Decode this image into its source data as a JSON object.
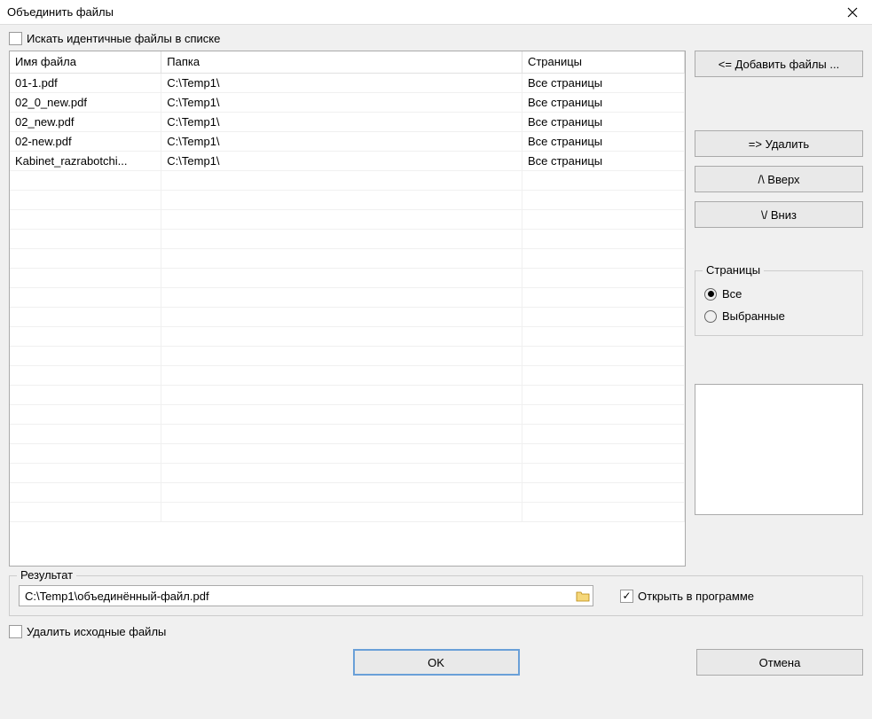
{
  "window": {
    "title": "Объединить файлы"
  },
  "search_checkbox": {
    "checked": false,
    "label": "Искать идентичные файлы в списке"
  },
  "table": {
    "headers": {
      "name": "Имя файла",
      "folder": "Папка",
      "pages": "Страницы"
    },
    "rows": [
      {
        "name": "01-1.pdf",
        "folder": "C:\\Temp1\\",
        "pages": "Все страницы"
      },
      {
        "name": "02_0_new.pdf",
        "folder": "C:\\Temp1\\",
        "pages": "Все страницы"
      },
      {
        "name": "02_new.pdf",
        "folder": "C:\\Temp1\\",
        "pages": "Все страницы"
      },
      {
        "name": "02-new.pdf",
        "folder": "C:\\Temp1\\",
        "pages": "Все страницы"
      },
      {
        "name": "Kabinet_razrabotchi...",
        "folder": "C:\\Temp1\\",
        "pages": "Все страницы"
      }
    ]
  },
  "buttons": {
    "add_files": "<=  Добавить файлы ...",
    "delete": "=>  Удалить",
    "up": "/\\   Вверх",
    "down": "\\/   Вниз",
    "ok": "OK",
    "cancel": "Отмена"
  },
  "pages_group": {
    "title": "Страницы",
    "all": "Все",
    "selected": "Выбранные",
    "value": "all"
  },
  "result": {
    "title": "Результат",
    "path": "C:\\Temp1\\объединённый-файл.pdf",
    "open_label": "Открыть в программе",
    "open_checked": true
  },
  "delete_source": {
    "label": "Удалить исходные файлы",
    "checked": false
  }
}
